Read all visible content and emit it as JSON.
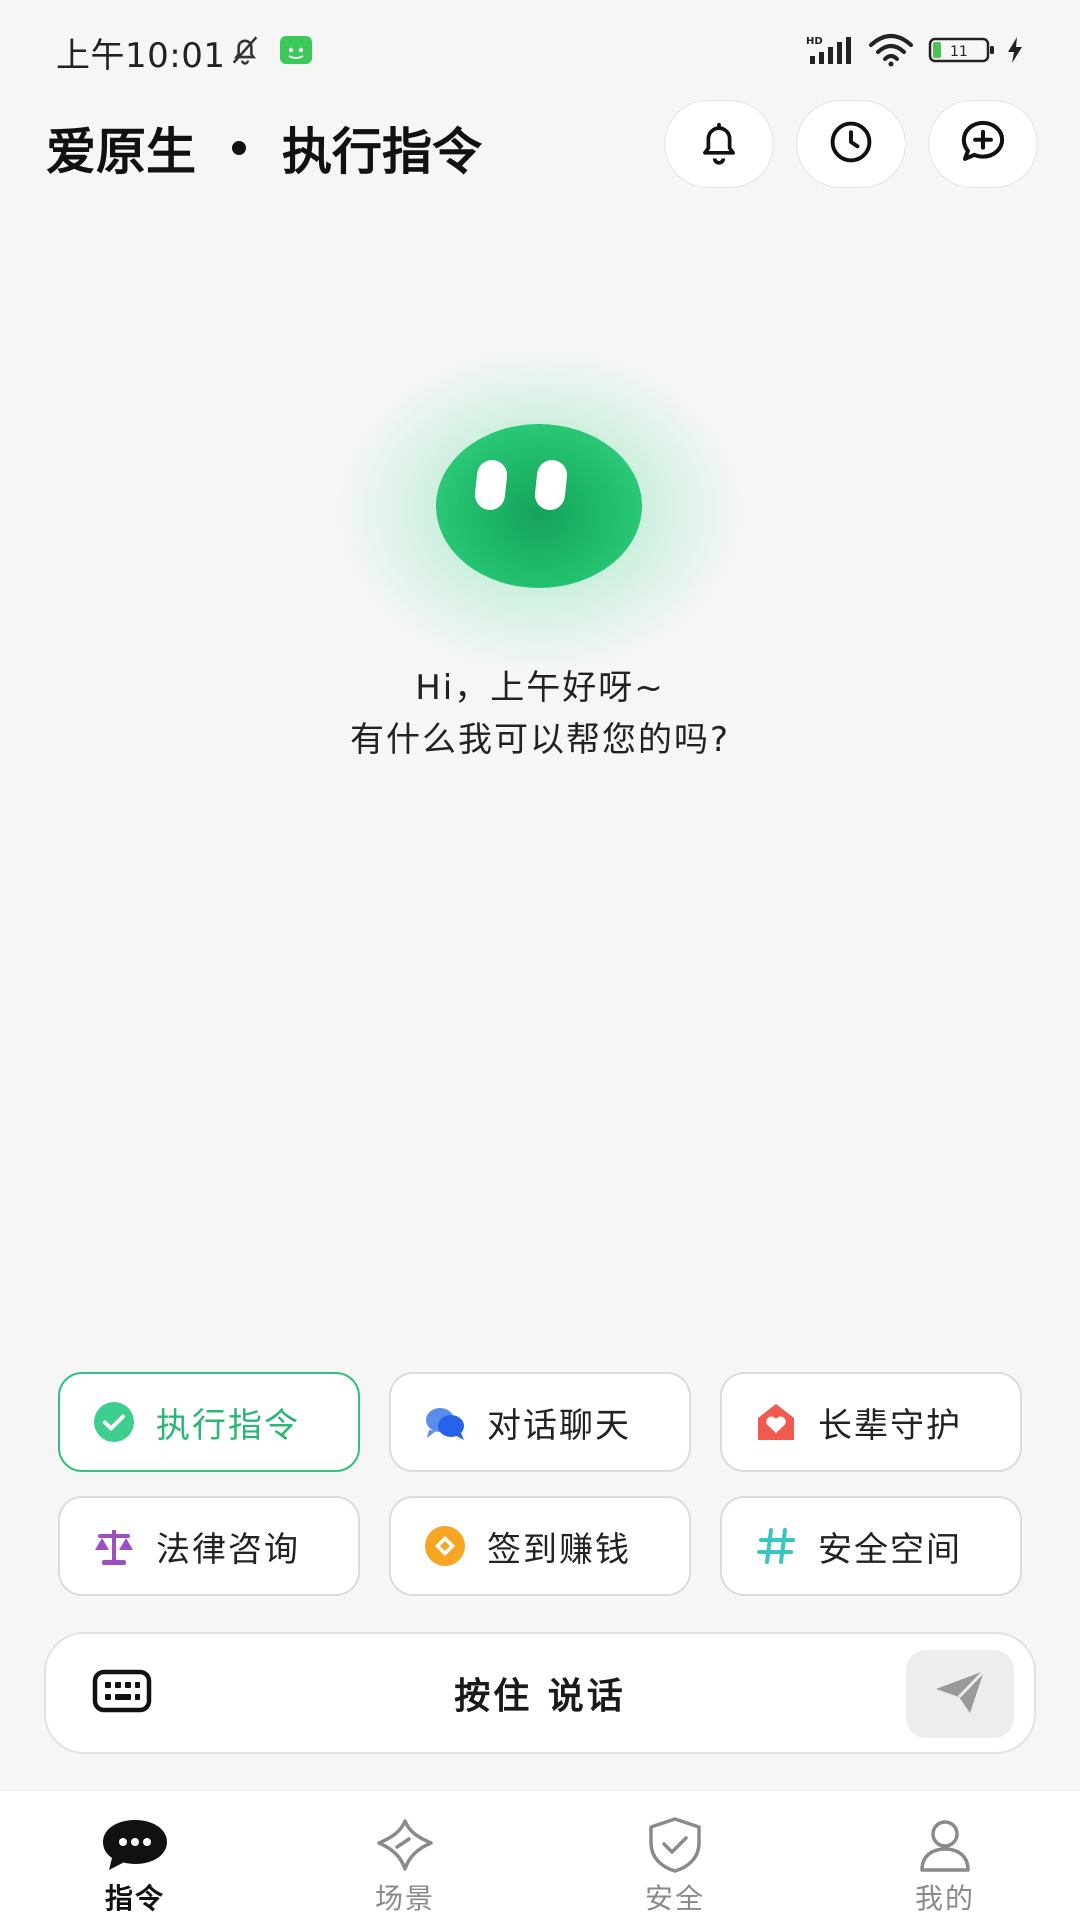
{
  "status_bar": {
    "time": "上午10:01",
    "battery": "11",
    "network": "HD"
  },
  "header": {
    "app_name": "爱原生",
    "mode": "执行指令",
    "buttons": [
      "bell-icon",
      "clock-icon",
      "new-chat-icon"
    ]
  },
  "greeting": {
    "line1": "Hi，上午好呀~",
    "line2": "有什么我可以帮您的吗?"
  },
  "quick_actions": [
    {
      "label": "执行指令",
      "icon": "check-circle-icon",
      "color": "#3ecf8e",
      "active": true
    },
    {
      "label": "对话聊天",
      "icon": "chat-bubbles-icon",
      "color": "#3b82f6",
      "active": false
    },
    {
      "label": "长辈守护",
      "icon": "heart-house-icon",
      "color": "#ef5b4f",
      "active": false
    },
    {
      "label": "法律咨询",
      "icon": "scales-icon",
      "color": "#9b4fc2",
      "active": false
    },
    {
      "label": "签到赚钱",
      "icon": "coin-icon",
      "color": "#f5a623",
      "active": false
    },
    {
      "label": "安全空间",
      "icon": "hash-icon",
      "color": "#39c6c0",
      "active": false
    }
  ],
  "input_bar": {
    "voice_label": "按住 说话"
  },
  "bottom_nav": [
    {
      "label": "指令",
      "icon": "chat-dots-icon",
      "active": true
    },
    {
      "label": "场景",
      "icon": "diamond-icon",
      "active": false
    },
    {
      "label": "安全",
      "icon": "shield-check-icon",
      "active": false
    },
    {
      "label": "我的",
      "icon": "user-icon",
      "active": false
    }
  ],
  "colors": {
    "accent": "#2bb673",
    "mascot": "#22c06e"
  }
}
